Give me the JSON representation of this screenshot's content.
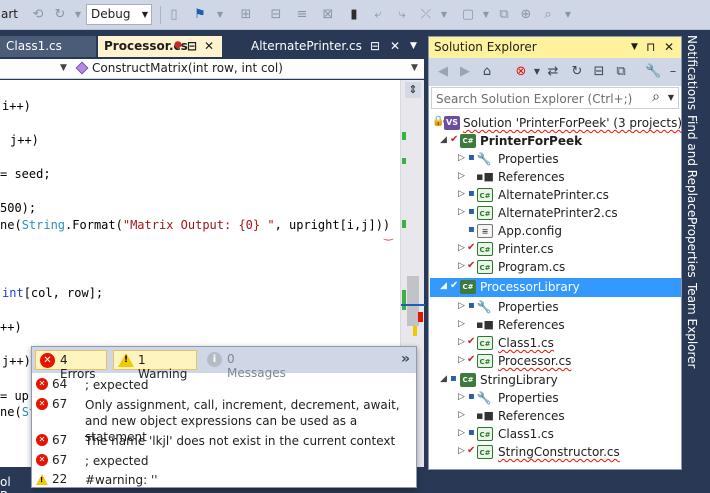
{
  "toolbar": {
    "left_text": "art",
    "configuration": "Debug"
  },
  "editor_tabs": [
    {
      "label": "Class1.cs"
    },
    {
      "label": "Processor.cs"
    },
    {
      "label": "AlternatePrinter.cs"
    }
  ],
  "navbar": {
    "member": "ConstructMatrix(int row, int col)"
  },
  "code": {
    "line1": "i++)",
    "line2": "j++)",
    "line3_op": "=",
    "line3_rest": " seed;",
    "line4": "500);",
    "line5_a": "ne(",
    "line5_type": "String",
    "line5_b": ".Format(",
    "line5_str": "\"Matrix Output: {0} \"",
    "line5_c": ", upright[i,j]))",
    "line6_kw": "int",
    "line6_rest": "[col, row];",
    "line7": "++)",
    "line8": "j++)",
    "line9": "= up",
    "line10_a": "ne(",
    "line10_type": "St"
  },
  "error_list": {
    "errors_label": "4 Errors",
    "warnings_label": "1 Warning",
    "messages_label": "0 Messages",
    "rows": [
      {
        "kind": "error",
        "line": "64",
        "description": "; expected"
      },
      {
        "kind": "error",
        "line": "67",
        "description": "Only assignment, call, increment, decrement, await, and new object expressions can be used as a statement"
      },
      {
        "kind": "error",
        "line": "67",
        "description": "The name 'lkjl' does not exist in the current context"
      },
      {
        "kind": "error",
        "line": "67",
        "description": "; expected"
      },
      {
        "kind": "warning",
        "line": "22",
        "description": "#warning: ''"
      }
    ]
  },
  "statusbar": {
    "text": "ol Res"
  },
  "solution_explorer": {
    "title": "Solution Explorer",
    "search_placeholder": "Search Solution Explorer (Ctrl+;)",
    "tree": [
      {
        "label": "Solution 'PrinterForPeek' (3 projects)",
        "icon": "solution-icon"
      },
      {
        "label": "PrinterForPeek",
        "icon": "csharp-project-icon"
      },
      {
        "label": "Properties",
        "icon": "wrench-icon"
      },
      {
        "label": "References",
        "icon": "references-icon"
      },
      {
        "label": "AlternatePrinter.cs",
        "icon": "csharp-file-icon"
      },
      {
        "label": "AlternatePrinter2.cs",
        "icon": "csharp-file-icon"
      },
      {
        "label": "App.config",
        "icon": "config-file-icon"
      },
      {
        "label": "Printer.cs",
        "icon": "csharp-file-icon"
      },
      {
        "label": "Program.cs",
        "icon": "csharp-file-icon"
      },
      {
        "label": "ProcessorLibrary",
        "icon": "csharp-project-icon"
      },
      {
        "label": "Properties",
        "icon": "wrench-icon"
      },
      {
        "label": "References",
        "icon": "references-icon"
      },
      {
        "label": "Class1.cs",
        "icon": "csharp-file-icon"
      },
      {
        "label": "Processor.cs",
        "icon": "csharp-file-icon"
      },
      {
        "label": "StringLibrary",
        "icon": "csharp-project-icon"
      },
      {
        "label": "Properties",
        "icon": "wrench-icon"
      },
      {
        "label": "References",
        "icon": "references-icon"
      },
      {
        "label": "Class1.cs",
        "icon": "csharp-file-icon"
      },
      {
        "label": "StringConstructor.cs",
        "icon": "csharp-file-icon"
      }
    ]
  },
  "side_tabs": [
    "Notifications",
    "Find and Replace",
    "Properties",
    "Team Explorer"
  ],
  "colors": {
    "chrome": "#293955",
    "selection": "#3399ff",
    "active_tab": "#fff4cf",
    "panel_title": "#fff29d",
    "error": "#e51400",
    "warning": "#f2c800"
  }
}
